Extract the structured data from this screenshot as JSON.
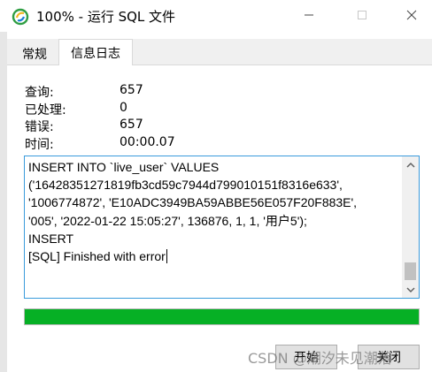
{
  "window": {
    "title": "100% - 运行 SQL 文件",
    "icons": {
      "app": "navicat-icon",
      "minimize": "minimize-icon",
      "maximize": "maximize-icon",
      "close": "close-icon"
    }
  },
  "tabs": [
    {
      "label": "常规",
      "active": false
    },
    {
      "label": "信息日志",
      "active": true
    }
  ],
  "stats": [
    {
      "label": "查询:",
      "value": "657"
    },
    {
      "label": "已处理:",
      "value": "0"
    },
    {
      "label": "错误:",
      "value": "657"
    },
    {
      "label": "时间:",
      "value": "00:00.07"
    }
  ],
  "log": {
    "text": "INSERT INTO `live_user` VALUES\n('16428351271819fb3cd59c7944d799010151f8316e633',\n'1006774872', 'E10ADC3949BA59ABBE56E057F20F883E',\n'005', '2022-01-22 15:05:27', 136876, 1, 1, '用户5');\nINSERT\n[SQL] Finished with error"
  },
  "progress": {
    "percent": 100,
    "color": "#06b025"
  },
  "buttons": {
    "start": "开始",
    "close": "关闭"
  },
  "watermark": "CSDN @潮汐未见潮落",
  "colors": {
    "log_border": "#3a9bdc"
  }
}
